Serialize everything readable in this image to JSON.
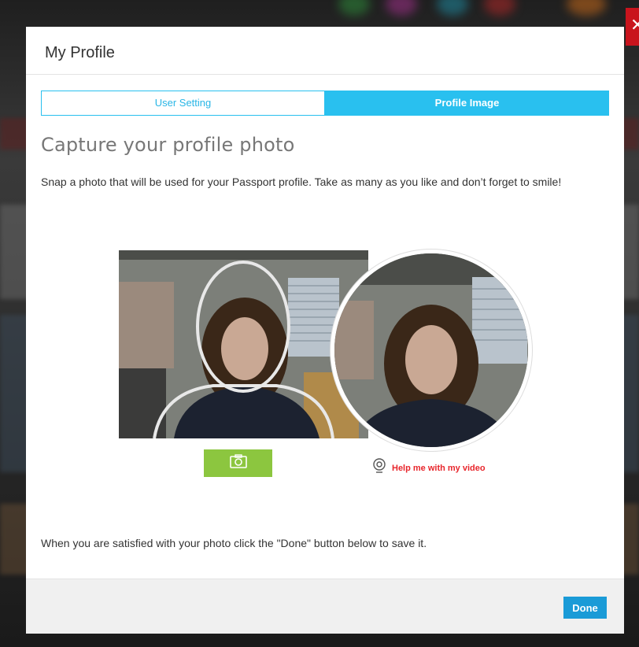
{
  "modal": {
    "title": "My Profile",
    "close_icon": "close-icon"
  },
  "tabs": [
    {
      "label": "User Setting",
      "active": false
    },
    {
      "label": "Profile Image",
      "active": true
    }
  ],
  "content": {
    "heading": "Capture your profile photo",
    "description": "Snap a photo that will be used for your Passport profile. Take as many as you like and don’t forget to smile!",
    "snap_icon": "camera-icon",
    "help_icon": "webcam-icon",
    "help_label": "Help me with my video",
    "footer_note": "When you are satisfied with your photo click the \"Done\" button below to save it."
  },
  "footer": {
    "done_label": "Done"
  },
  "colors": {
    "tab_accent": "#29c0ef",
    "snap_button": "#8cc63f",
    "help_text": "#e8262c",
    "done_button": "#1a9bd7",
    "close_button": "#c9141d"
  }
}
